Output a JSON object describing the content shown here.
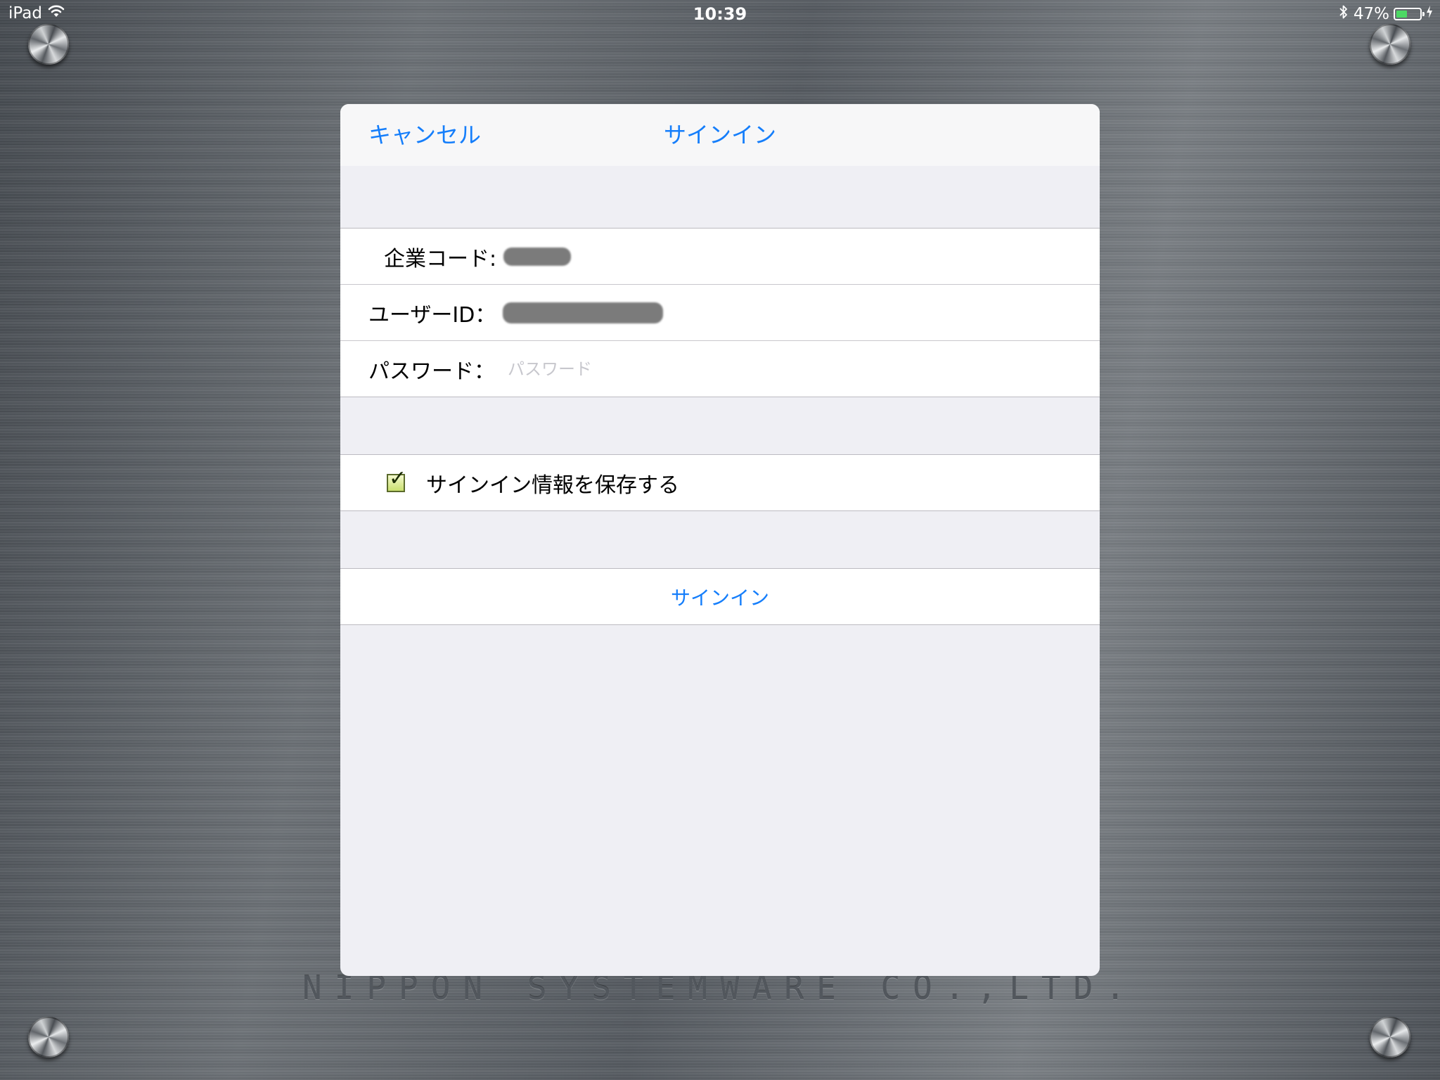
{
  "status_bar": {
    "device": "iPad",
    "time": "10:39",
    "battery_percent_label": "47%",
    "battery_level": 0.47,
    "icons": [
      "wifi-icon",
      "bluetooth-icon",
      "battery-icon",
      "charging-bolt-icon"
    ]
  },
  "background": {
    "engraved_text": "NIPPON SYSTEMWARE CO.,LTD."
  },
  "modal": {
    "cancel_label": "キャンセル",
    "title": "サインイン",
    "form": {
      "company_code_label": "企業コード:",
      "user_id_label": "ユーザーID：",
      "password_label": "パスワード：",
      "password_placeholder": "パスワード",
      "password_value": ""
    },
    "save_checkbox": {
      "label": "サインイン情報を保存する",
      "checked": true
    },
    "signin_button_label": "サインイン"
  },
  "colors": {
    "ios_blue": "#157efb",
    "sheet_background": "#efeff4",
    "battery_green": "#4cd964"
  }
}
